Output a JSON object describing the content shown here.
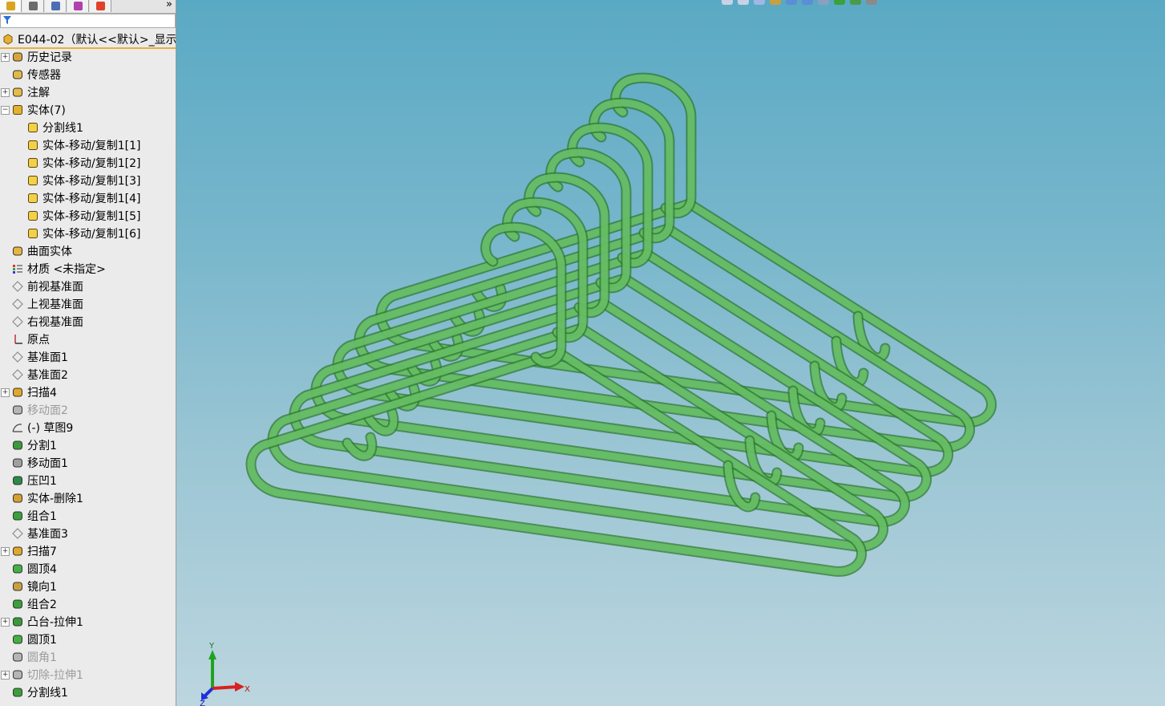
{
  "feature_tree": {
    "tabs": [
      {
        "name": "feature-manager-tab",
        "icon": "feature-manager-icon",
        "active": true
      },
      {
        "name": "property-manager-tab",
        "icon": "property-manager-icon",
        "active": false
      },
      {
        "name": "configuration-manager-tab",
        "icon": "configuration-manager-icon",
        "active": false
      },
      {
        "name": "dimxpert-tab",
        "icon": "dimxpert-icon",
        "active": false
      },
      {
        "name": "display-manager-tab",
        "icon": "display-manager-icon",
        "active": false
      }
    ],
    "more_label": "»",
    "filter_value": "",
    "root_label": "E044-02（默认<<默认>_显示",
    "items": [
      {
        "label": "历史记录",
        "icon": "history-icon",
        "expandable": true,
        "dim": false,
        "indent": 0
      },
      {
        "label": "传感器",
        "icon": "sensor-icon",
        "expandable": false,
        "dim": false,
        "indent": 0
      },
      {
        "label": "注解",
        "icon": "annotation-icon",
        "expandable": true,
        "dim": false,
        "indent": 0
      },
      {
        "label": "实体(7)",
        "icon": "solid-bodies-folder-icon",
        "expandable": true,
        "expanded": true,
        "dim": false,
        "indent": 0
      },
      {
        "label": "分割线1",
        "icon": "solid-body-icon",
        "expandable": false,
        "dim": false,
        "indent": 1
      },
      {
        "label": "实体-移动/复制1[1]",
        "icon": "solid-body-icon",
        "expandable": false,
        "dim": false,
        "indent": 1
      },
      {
        "label": "实体-移动/复制1[2]",
        "icon": "solid-body-icon",
        "expandable": false,
        "dim": false,
        "indent": 1
      },
      {
        "label": "实体-移动/复制1[3]",
        "icon": "solid-body-icon",
        "expandable": false,
        "dim": false,
        "indent": 1
      },
      {
        "label": "实体-移动/复制1[4]",
        "icon": "solid-body-icon",
        "expandable": false,
        "dim": false,
        "indent": 1
      },
      {
        "label": "实体-移动/复制1[5]",
        "icon": "solid-body-icon",
        "expandable": false,
        "dim": false,
        "indent": 1
      },
      {
        "label": "实体-移动/复制1[6]",
        "icon": "solid-body-icon",
        "expandable": false,
        "dim": false,
        "indent": 1
      },
      {
        "label": "曲面实体",
        "icon": "surface-bodies-icon",
        "expandable": false,
        "dim": false,
        "indent": 0
      },
      {
        "label": "材质 <未指定>",
        "icon": "material-icon",
        "expandable": false,
        "dim": false,
        "indent": 0
      },
      {
        "label": "前视基准面",
        "icon": "plane-icon",
        "expandable": false,
        "dim": false,
        "indent": 0
      },
      {
        "label": "上视基准面",
        "icon": "plane-icon",
        "expandable": false,
        "dim": false,
        "indent": 0
      },
      {
        "label": "右视基准面",
        "icon": "plane-icon",
        "expandable": false,
        "dim": false,
        "indent": 0
      },
      {
        "label": "原点",
        "icon": "origin-icon",
        "expandable": false,
        "dim": false,
        "indent": 0
      },
      {
        "label": "基准面1",
        "icon": "plane-icon",
        "expandable": false,
        "dim": false,
        "indent": 0
      },
      {
        "label": "基准面2",
        "icon": "plane-icon",
        "expandable": false,
        "dim": false,
        "indent": 0
      },
      {
        "label": "扫描4",
        "icon": "sweep-icon",
        "expandable": true,
        "dim": false,
        "indent": 0
      },
      {
        "label": "移动面2",
        "icon": "move-face-icon",
        "expandable": false,
        "dim": true,
        "indent": 0
      },
      {
        "label": "(-) 草图9",
        "icon": "sketch-icon",
        "expandable": false,
        "dim": false,
        "indent": 0
      },
      {
        "label": "分割1",
        "icon": "split-icon",
        "expandable": false,
        "dim": false,
        "indent": 0
      },
      {
        "label": "移动面1",
        "icon": "move-face-icon",
        "expandable": false,
        "dim": false,
        "indent": 0
      },
      {
        "label": "压凹1",
        "icon": "indent-icon",
        "expandable": false,
        "dim": false,
        "indent": 0
      },
      {
        "label": "实体-删除1",
        "icon": "delete-body-icon",
        "expandable": false,
        "dim": false,
        "indent": 0
      },
      {
        "label": "组合1",
        "icon": "combine-icon",
        "expandable": false,
        "dim": false,
        "indent": 0
      },
      {
        "label": "基准面3",
        "icon": "plane-icon",
        "expandable": false,
        "dim": false,
        "indent": 0
      },
      {
        "label": "扫描7",
        "icon": "sweep-icon",
        "expandable": true,
        "dim": false,
        "indent": 0
      },
      {
        "label": "圆顶4",
        "icon": "dome-icon",
        "expandable": false,
        "dim": false,
        "indent": 0
      },
      {
        "label": "镜向1",
        "icon": "mirror-icon",
        "expandable": false,
        "dim": false,
        "indent": 0
      },
      {
        "label": "组合2",
        "icon": "combine-icon",
        "expandable": false,
        "dim": false,
        "indent": 0
      },
      {
        "label": "凸台-拉伸1",
        "icon": "boss-extrude-icon",
        "expandable": true,
        "dim": false,
        "indent": 0
      },
      {
        "label": "圆顶1",
        "icon": "dome-icon",
        "expandable": false,
        "dim": false,
        "indent": 0
      },
      {
        "label": "圆角1",
        "icon": "fillet-icon",
        "expandable": false,
        "dim": true,
        "indent": 0
      },
      {
        "label": "切除-拉伸1",
        "icon": "cut-extrude-icon",
        "expandable": true,
        "dim": true,
        "indent": 0
      },
      {
        "label": "分割线1",
        "icon": "split-line-icon",
        "expandable": false,
        "dim": false,
        "indent": 0
      }
    ]
  },
  "view_toolbar": {
    "icons": [
      "zoom-to-fit-icon",
      "zoom-to-area-icon",
      "previous-view-icon",
      "section-view-icon",
      "view-orientation-icon",
      "display-style-icon",
      "hide-show-items-icon",
      "edit-appearance-icon",
      "apply-scene-icon",
      "view-settings-icon"
    ]
  },
  "model": {
    "name": "clothes-hanger-stack",
    "color": "#6cc46a",
    "edge_color": "#2f7a30",
    "copies": 7
  },
  "triad": {
    "x_label": "X",
    "y_label": "Y",
    "z_label": "Z"
  },
  "colors": {
    "viewport_top": "#5aa9c4",
    "viewport_bottom": "#bcd6df",
    "panel_bg": "#ecebec",
    "selection_line": "#e5b23b"
  }
}
